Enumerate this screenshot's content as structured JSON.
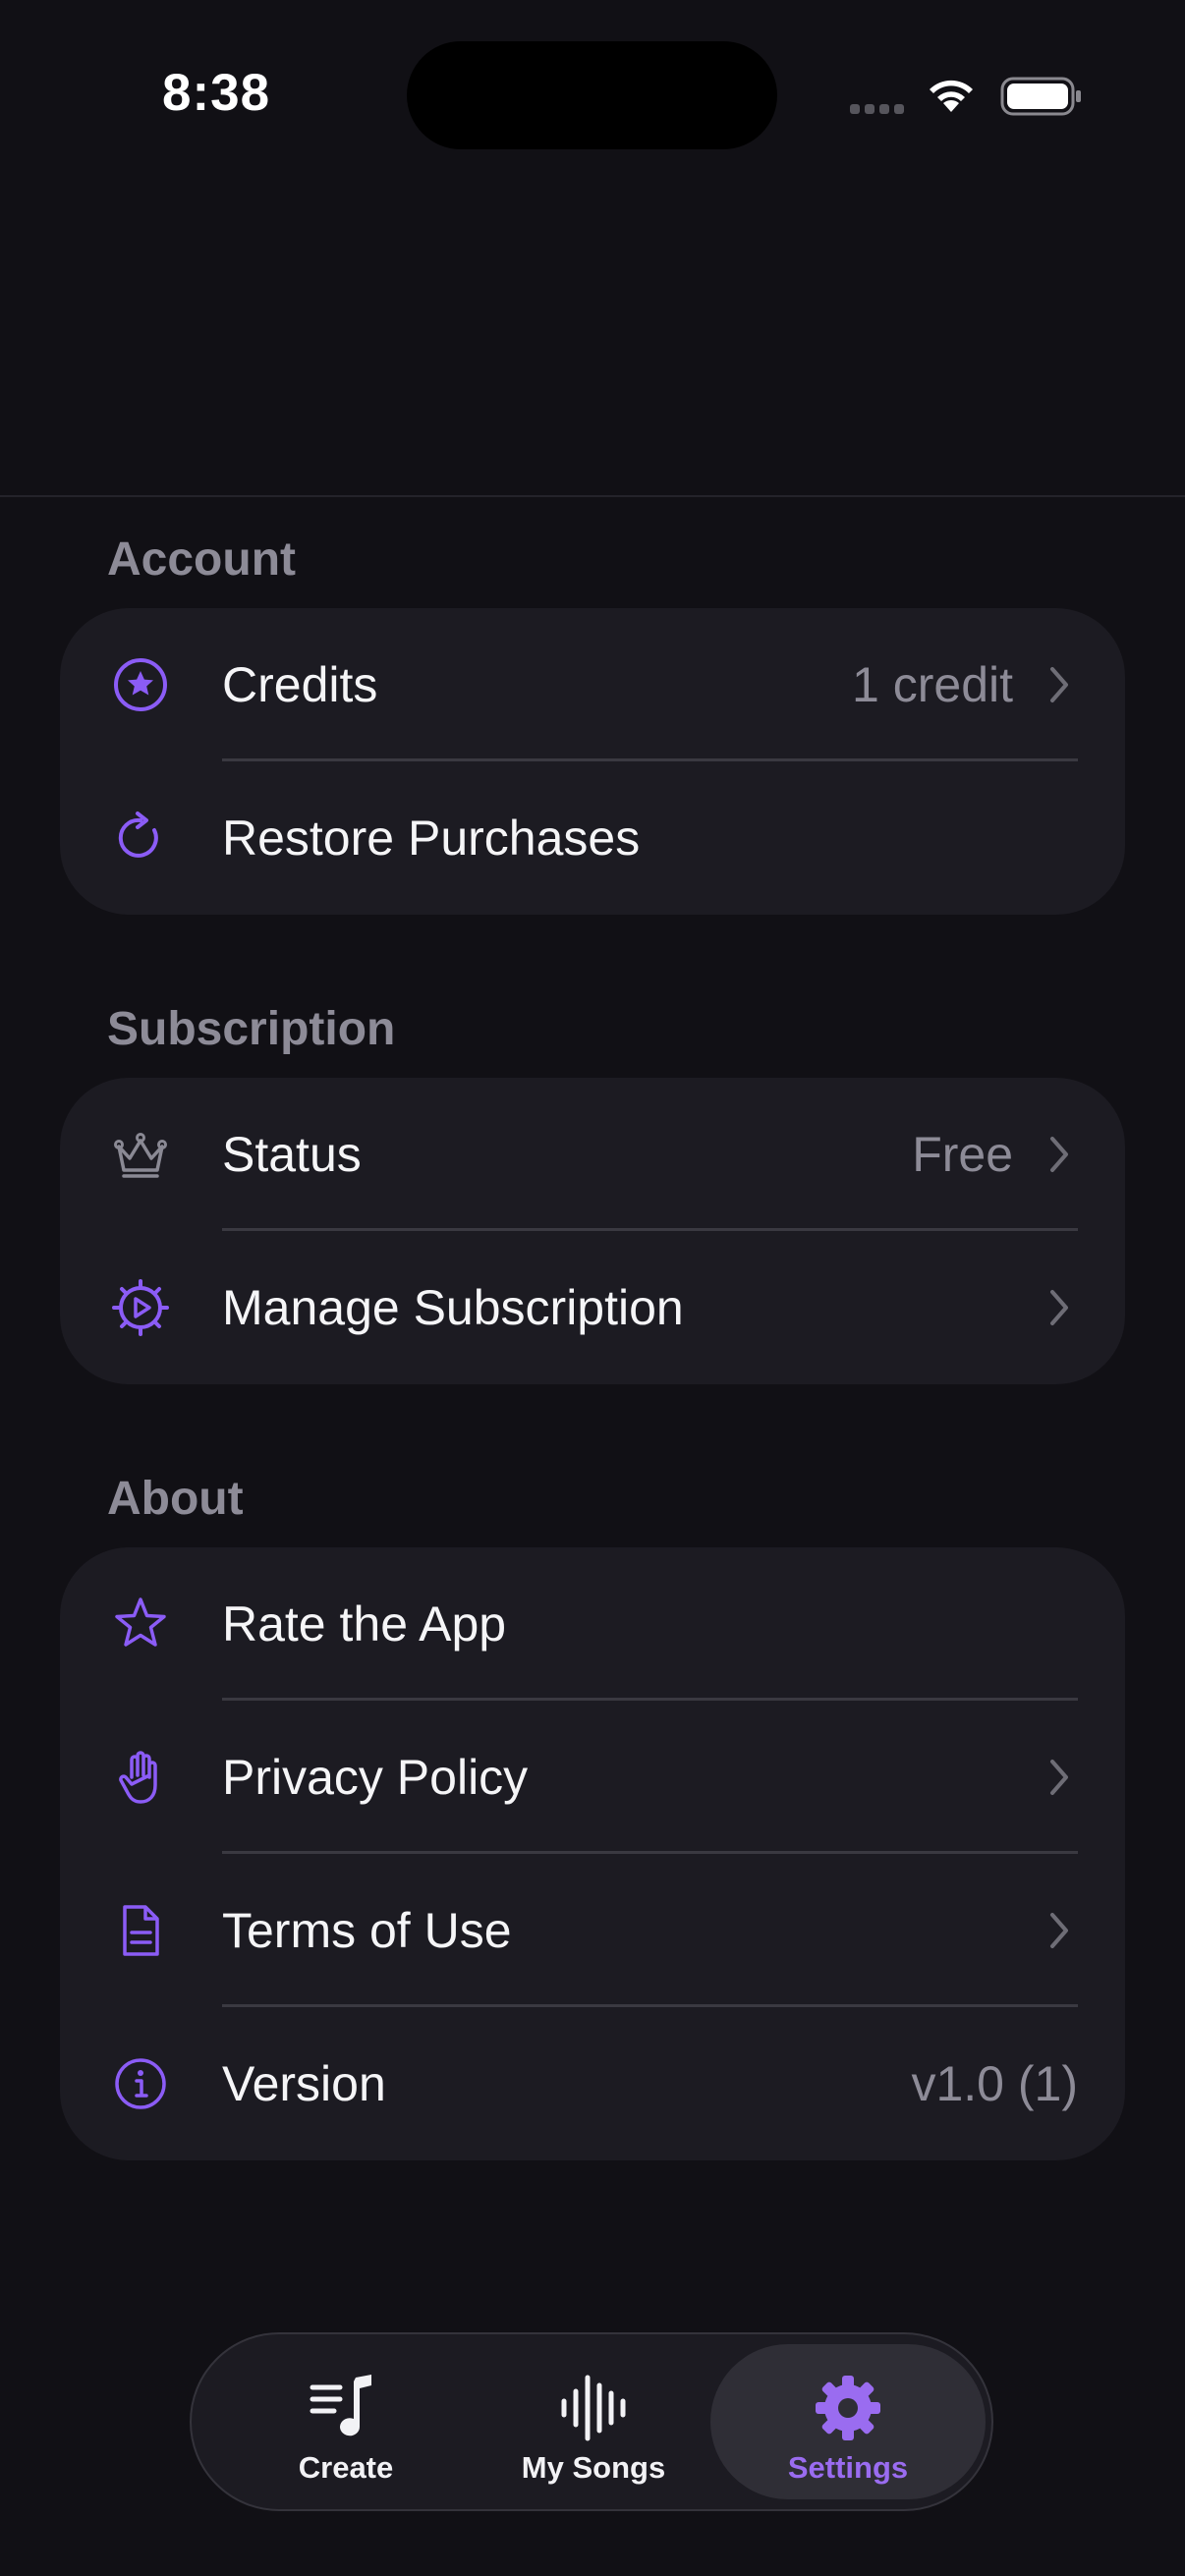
{
  "status_bar": {
    "time": "8:38"
  },
  "colors": {
    "background": "#111015",
    "card": "#1c1b22",
    "accent": "#8b5cf6",
    "secondary_text": "#8d8b97"
  },
  "sections": {
    "account": {
      "title": "Account",
      "rows": [
        {
          "label": "Credits",
          "value": "1 credit",
          "icon": "star-circle-icon",
          "chevron": true
        },
        {
          "label": "Restore Purchases",
          "icon": "restore-arrow-icon",
          "chevron": false
        }
      ]
    },
    "subscription": {
      "title": "Subscription",
      "rows": [
        {
          "label": "Status",
          "value": "Free",
          "icon": "crown-icon",
          "chevron": true
        },
        {
          "label": "Manage Subscription",
          "icon": "gear-play-icon",
          "chevron": true
        }
      ]
    },
    "about": {
      "title": "About",
      "rows": [
        {
          "label": "Rate the App",
          "icon": "star-icon",
          "chevron": false
        },
        {
          "label": "Privacy Policy",
          "icon": "hand-icon",
          "chevron": true
        },
        {
          "label": "Terms of Use",
          "icon": "document-icon",
          "chevron": true
        },
        {
          "label": "Version",
          "value": "v1.0 (1)",
          "icon": "info-icon",
          "chevron": false
        }
      ]
    }
  },
  "tab_bar": {
    "tabs": [
      {
        "label": "Create",
        "icon": "music-note-list-icon",
        "active": false
      },
      {
        "label": "My Songs",
        "icon": "waveform-icon",
        "active": false
      },
      {
        "label": "Settings",
        "icon": "gear-icon",
        "active": true
      }
    ]
  }
}
